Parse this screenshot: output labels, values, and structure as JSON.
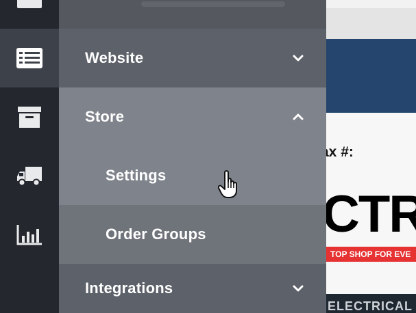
{
  "menu": {
    "items": [
      {
        "label": "Website",
        "chevron": "chevron-down-icon"
      },
      {
        "label": "Store",
        "chevron": "chevron-up-icon",
        "expanded": true
      },
      {
        "label": "Settings",
        "submenu": true,
        "hovered": true
      },
      {
        "label": "Order Groups",
        "submenu": true
      },
      {
        "label": "Integrations",
        "chevron": "chevron-down-icon"
      }
    ]
  },
  "rail": {
    "icons": [
      "list-icon",
      "archive-box-icon",
      "truck-icon",
      "bar-chart-icon"
    ],
    "active": "list-icon"
  },
  "page": {
    "fax_label": "ax #:",
    "logo_text": "CTR",
    "tagline": "TOP SHOP FOR EVE",
    "footer_text": "ELECTRICAL"
  },
  "colors": {
    "rail_bg": "#24272d",
    "rail_active": "#3d4149",
    "menu_bg": "#5d6169",
    "menu_selected": "#7f838b",
    "banner": "#26456e",
    "tagline_bg": "#e63232"
  }
}
